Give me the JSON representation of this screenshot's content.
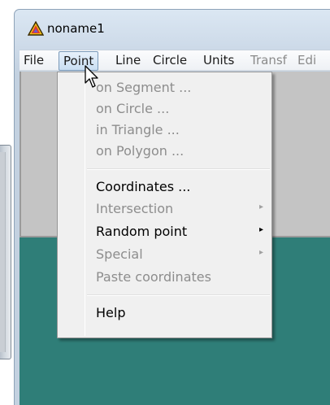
{
  "window": {
    "title": "noname1",
    "icon": "triangle-app-icon"
  },
  "menubar": {
    "items": [
      {
        "label": "File",
        "enabled": true
      },
      {
        "label": "Point",
        "enabled": true,
        "active": true
      },
      {
        "label": "Line",
        "enabled": true
      },
      {
        "label": "Circle",
        "enabled": true
      },
      {
        "label": "Units",
        "enabled": true
      },
      {
        "label": "Transf",
        "enabled": false
      },
      {
        "label": "Edi",
        "enabled": false
      }
    ]
  },
  "point_menu": {
    "items": [
      {
        "label": "on Segment ...",
        "enabled": false,
        "submenu": false
      },
      {
        "label": "on Circle ...",
        "enabled": false,
        "submenu": false
      },
      {
        "label": "in Triangle ...",
        "enabled": false,
        "submenu": false
      },
      {
        "label": "on Polygon ...",
        "enabled": false,
        "submenu": false
      },
      {
        "label": "Coordinates ...",
        "enabled": true,
        "submenu": false
      },
      {
        "label": "Intersection",
        "enabled": false,
        "submenu": true
      },
      {
        "label": "Random point",
        "enabled": true,
        "submenu": true
      },
      {
        "label": "Special",
        "enabled": false,
        "submenu": true
      },
      {
        "label": "Paste coordinates",
        "enabled": false,
        "submenu": false
      },
      {
        "label": "Help",
        "enabled": true,
        "submenu": false
      }
    ],
    "submenu_arrow": "▸"
  },
  "colors": {
    "canvas_gray": "#c4c4c4",
    "canvas_teal": "#2f7e78",
    "menu_bg": "#f0f0f0",
    "disabled_text": "#8d8d8d",
    "title_bar": "#cfdcea"
  }
}
